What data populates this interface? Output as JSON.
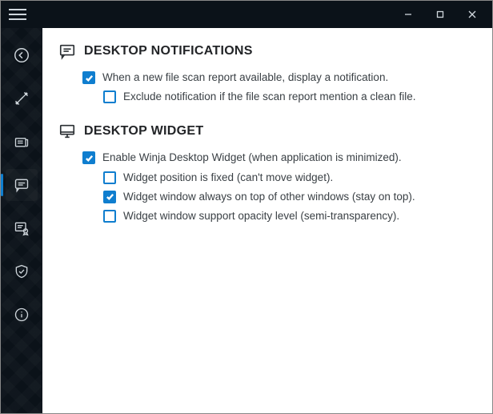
{
  "titlebar": {
    "hamburger_name": "menu-icon",
    "minimize_name": "minimize-button",
    "maximize_name": "maximize-button",
    "close_name": "close-button"
  },
  "sidebar": {
    "items": [
      {
        "name": "back-icon"
      },
      {
        "name": "tools-icon"
      },
      {
        "name": "news-icon"
      },
      {
        "name": "notifications-icon",
        "active": true
      },
      {
        "name": "certificate-icon"
      },
      {
        "name": "shield-icon"
      },
      {
        "name": "info-icon"
      }
    ]
  },
  "sections": [
    {
      "icon_name": "message-icon",
      "title": "DESKTOP NOTIFICATIONS",
      "options": [
        {
          "level": 1,
          "checked": true,
          "label": "When a new file scan report available, display a notification."
        },
        {
          "level": 2,
          "checked": false,
          "label": "Exclude notification if the file scan report mention a clean file."
        }
      ]
    },
    {
      "icon_name": "monitor-icon",
      "title": "DESKTOP WIDGET",
      "options": [
        {
          "level": 1,
          "checked": true,
          "label": "Enable Winja Desktop Widget (when application is minimized)."
        },
        {
          "level": 2,
          "checked": false,
          "label": "Widget position is fixed (can't move widget)."
        },
        {
          "level": 2,
          "checked": true,
          "label": "Widget window always on top of other windows (stay on top)."
        },
        {
          "level": 2,
          "checked": false,
          "label": "Widget window support opacity level (semi-transparency)."
        }
      ]
    }
  ]
}
